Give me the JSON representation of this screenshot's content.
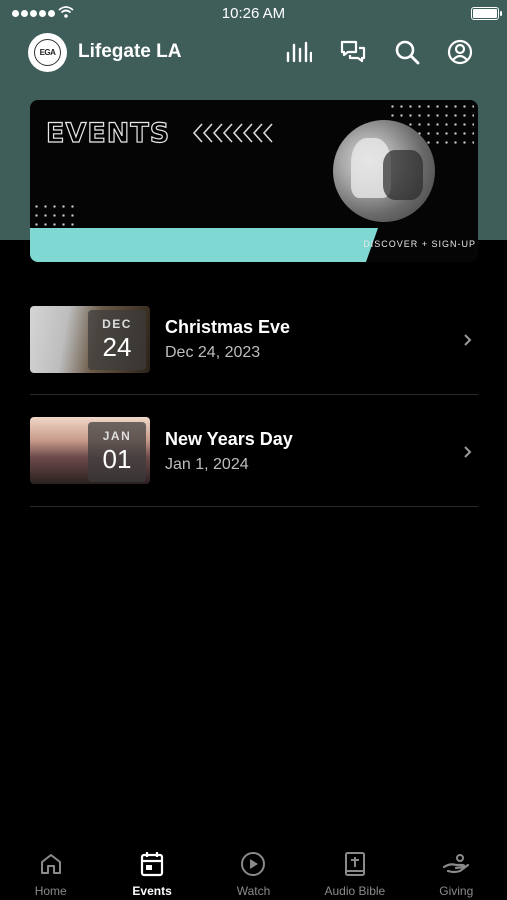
{
  "status_bar": {
    "time": "10:26 AM"
  },
  "header": {
    "logo_text": "EGA",
    "title": "Lifegate LA",
    "icons": [
      "equalizer-icon",
      "chat-icon",
      "search-icon",
      "profile-icon"
    ]
  },
  "banner": {
    "title": "EVENTS",
    "cta": "DISCOVER + SIGN-UP",
    "accent_color": "#7fd8d2"
  },
  "events": [
    {
      "title": "Christmas Eve",
      "date": "Dec 24, 2023",
      "badge_month": "DEC",
      "badge_day": "24"
    },
    {
      "title": "New Years Day",
      "date": "Jan 1, 2024",
      "badge_month": "JAN",
      "badge_day": "01"
    }
  ],
  "tabs": [
    {
      "label": "Home",
      "icon": "home-icon",
      "active": false
    },
    {
      "label": "Events",
      "icon": "calendar-icon",
      "active": true
    },
    {
      "label": "Watch",
      "icon": "play-icon",
      "active": false
    },
    {
      "label": "Audio Bible",
      "icon": "bible-icon",
      "active": false
    },
    {
      "label": "Giving",
      "icon": "giving-icon",
      "active": false
    }
  ],
  "colors": {
    "header_bg": "#3f5e5a",
    "background": "#000000",
    "inactive_tab": "#8a8a8a"
  }
}
